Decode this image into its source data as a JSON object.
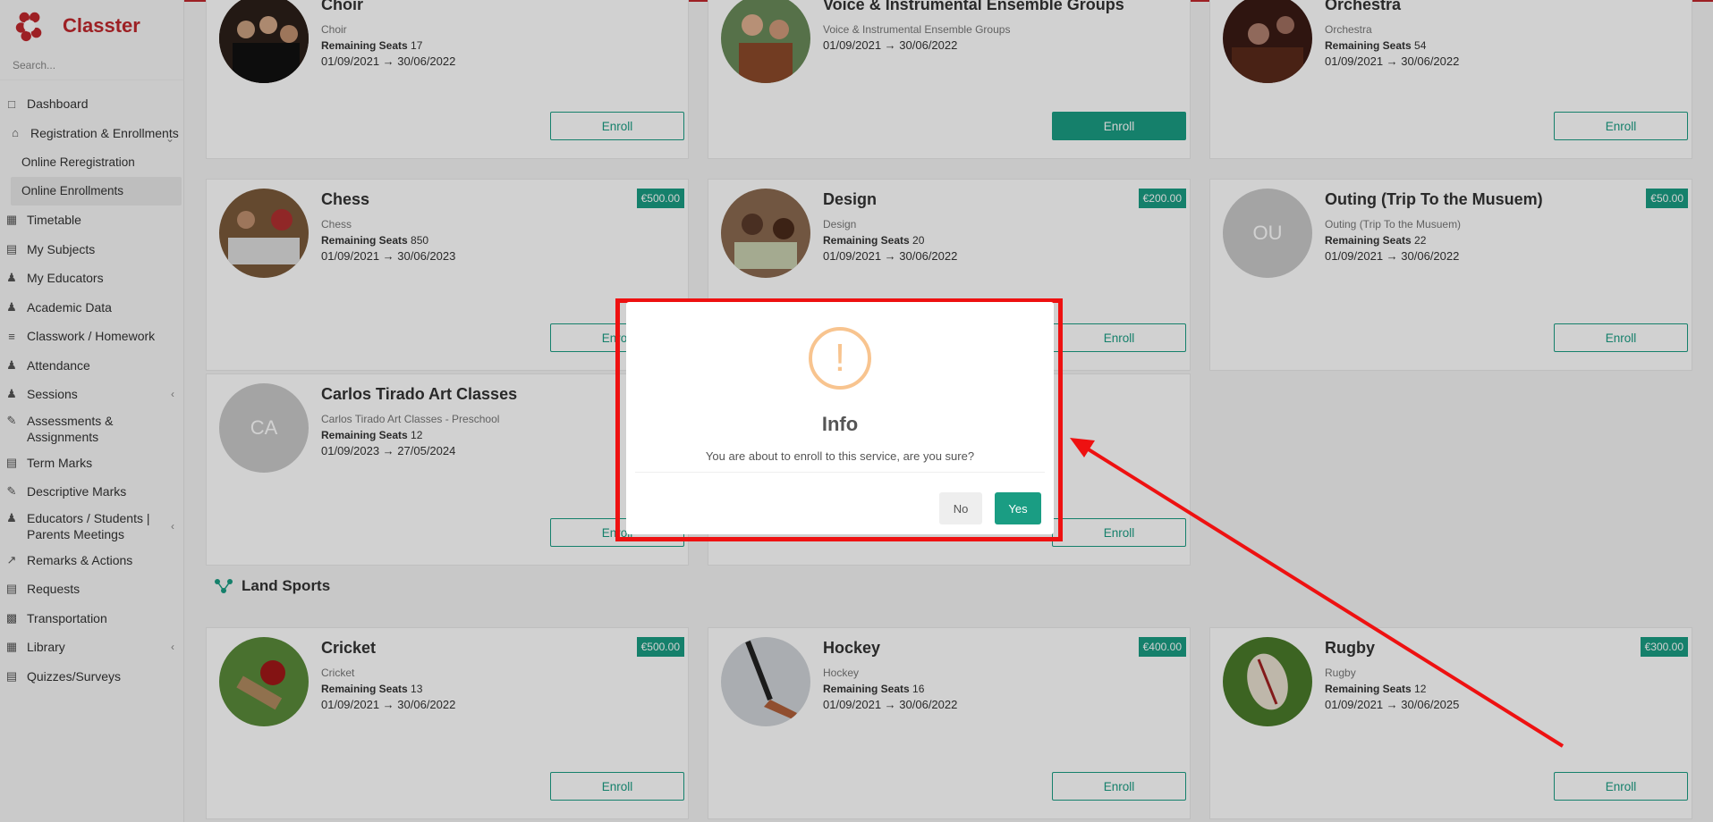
{
  "brand": {
    "name": "Classter"
  },
  "search": {
    "placeholder": "Search..."
  },
  "sidebar": {
    "items": [
      {
        "label": "Dashboard",
        "icon": "laptop-icon"
      },
      {
        "label": "Registration & Enrollments",
        "icon": "bank-icon"
      },
      {
        "label": "Online Reregistration"
      },
      {
        "label": "Online Enrollments"
      },
      {
        "label": "Timetable",
        "icon": "calendar-icon"
      },
      {
        "label": "My Subjects",
        "icon": "book-icon"
      },
      {
        "label": "My Educators",
        "icon": "users-icon"
      },
      {
        "label": "Academic Data",
        "icon": "user-icon"
      },
      {
        "label": "Classwork / Homework",
        "icon": "list-icon"
      },
      {
        "label": "Attendance",
        "icon": "user-check-icon"
      },
      {
        "label": "Sessions",
        "icon": "group-icon"
      },
      {
        "label": "Assessments & Assignments",
        "icon": "edit-icon"
      },
      {
        "label": "Term Marks",
        "icon": "book-icon"
      },
      {
        "label": "Descriptive Marks",
        "icon": "comment-icon"
      },
      {
        "label": "Educators / Students | Parents Meetings",
        "icon": "meeting-icon"
      },
      {
        "label": "Remarks & Actions",
        "icon": "chart-icon"
      },
      {
        "label": "Requests",
        "icon": "doc-icon"
      },
      {
        "label": "Transportation",
        "icon": "bus-icon"
      },
      {
        "label": "Library",
        "icon": "library-icon"
      },
      {
        "label": "Quizzes/Surveys",
        "icon": "quiz-icon"
      }
    ]
  },
  "cards": [
    {
      "title": "Choir",
      "sub": "Choir",
      "seats_label": "Remaining Seats",
      "seats": "17",
      "dates": "01/09/2021 → 30/06/2022",
      "price": "",
      "enroll": "Enroll"
    },
    {
      "title": "Voice & Instrumental Ensemble Groups",
      "sub": "Voice & Instrumental Ensemble Groups",
      "seats_label": "",
      "seats": "",
      "dates": "01/09/2021 → 30/06/2022",
      "price": "",
      "enroll": "Enroll"
    },
    {
      "title": "Orchestra",
      "sub": "Orchestra",
      "seats_label": "Remaining Seats",
      "seats": "54",
      "dates": "01/09/2021 → 30/06/2022",
      "price": "",
      "enroll": "Enroll"
    },
    {
      "title": "Chess",
      "sub": "Chess",
      "seats_label": "Remaining Seats",
      "seats": "850",
      "dates": "01/09/2021 → 30/06/2023",
      "price": "€500.00",
      "enroll": "Enroll"
    },
    {
      "title": "Design",
      "sub": "Design",
      "seats_label": "Remaining Seats",
      "seats": "20",
      "dates": "01/09/2021 → 30/06/2022",
      "price": "€200.00",
      "enroll": "Enroll"
    },
    {
      "title": "Outing (Trip To the Musuem)",
      "sub": "Outing (Trip To the Musuem)",
      "seats_label": "Remaining Seats",
      "seats": "22",
      "dates": "01/09/2021 → 30/06/2022",
      "price": "€50.00",
      "enroll": "Enroll",
      "initials": "OU"
    },
    {
      "title": "Carlos Tirado Art Classes",
      "sub": "Carlos Tirado Art Classes - Preschool",
      "seats_label": "Remaining Seats",
      "seats": "12",
      "dates": "01/09/2023 → 27/05/2024",
      "price": "",
      "enroll": "Enroll",
      "initials": "CA"
    },
    {
      "title": "",
      "sub": "",
      "seats_label": "",
      "seats": "",
      "dates": "",
      "price": "",
      "enroll": "Enroll"
    },
    {
      "title": "Cricket",
      "sub": "Cricket",
      "seats_label": "Remaining Seats",
      "seats": "13",
      "dates": "01/09/2021 → 30/06/2022",
      "price": "€500.00",
      "enroll": "Enroll"
    },
    {
      "title": "Hockey",
      "sub": "Hockey",
      "seats_label": "Remaining Seats",
      "seats": "16",
      "dates": "01/09/2021 → 30/06/2022",
      "price": "€400.00",
      "enroll": "Enroll"
    },
    {
      "title": "Rugby",
      "sub": "Rugby",
      "seats_label": "Remaining Seats",
      "seats": "12",
      "dates": "01/09/2021 → 30/06/2025",
      "price": "€300.00",
      "enroll": "Enroll"
    }
  ],
  "section": {
    "title": "Land Sports"
  },
  "modal": {
    "title": "Info",
    "message": "You are about to enroll to this service, are you sure?",
    "no_label": "No",
    "yes_label": "Yes"
  },
  "colors": {
    "accent": "#1a9d83",
    "brand": "#c0282d",
    "highlight": "#ee1111",
    "warning": "#f8c48f"
  }
}
